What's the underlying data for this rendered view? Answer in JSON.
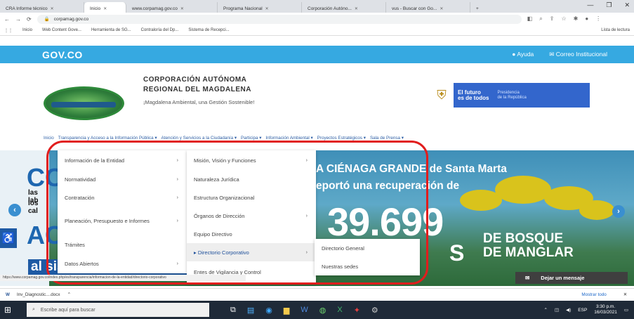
{
  "browser": {
    "tabs": [
      {
        "label": "CRA Informe técnico",
        "active": false
      },
      {
        "label": "Inicio",
        "active": true
      },
      {
        "label": "www.corpamag.gov.co",
        "active": false
      },
      {
        "label": "Programa Nacional",
        "active": false
      },
      {
        "label": "Corporación Autóno...",
        "active": false
      },
      {
        "label": "vus - Buscar con Go...",
        "active": false
      }
    ],
    "new_tab": "+",
    "url": "corpamag.gov.co",
    "bookmarks": [
      "Inicio",
      "Web Content Gove...",
      "Herramienta de SG...",
      "Contraloría del Dp...",
      "Sistema de Recepci..."
    ],
    "reading_list": "Lista de lectura"
  },
  "govco": {
    "logo": "GOV.CO",
    "help": "Ayuda",
    "mail": "Correo Institucional"
  },
  "header": {
    "corp_title_1": "CORPORACIÓN AUTÓNOMA",
    "corp_title_2": "REGIONAL DEL MAGDALENA",
    "corp_sub": "¡Magdalena Ambiental, una Gestión Sostenible!",
    "logo_text": "CORPAMAG",
    "gob_a1": "El futuro",
    "gob_a2": "es de todos",
    "gob_b1": "Presidencia",
    "gob_b2": "de la República"
  },
  "nav": {
    "items": [
      "Inicio",
      "Transparencia y Acceso a la Información Pública ▾",
      "Atención y Servicios a la Ciudadanía ▾",
      "Participa ▾",
      "Información Ambiental ▾",
      "Proyectos Estratégicos ▾",
      "Sala de Prensa ▾"
    ]
  },
  "menu1": [
    {
      "label": "Información de la Entidad",
      "chev": true
    },
    {
      "label": "Normatividad",
      "chev": true
    },
    {
      "label": "Contratación",
      "chev": true
    },
    {
      "label": "Planeación, Presupuesto e Informes",
      "chev": true
    },
    {
      "label": "Trámites",
      "chev": false
    },
    {
      "label": "Datos Abiertos",
      "chev": true
    }
  ],
  "menu2": [
    {
      "label": "Misión, Visión y Funciones",
      "chev": true
    },
    {
      "label": "Naturaleza Jurídica",
      "chev": false
    },
    {
      "label": "Estructura Organizacional",
      "chev": false
    },
    {
      "label": "Órganos de Dirección",
      "chev": true
    },
    {
      "label": "Equipo Directivo",
      "chev": false
    },
    {
      "label": "▸ Directorio Corporativo",
      "chev": true,
      "active": true
    },
    {
      "label": "Entes de Vigilancia y Control",
      "chev": false
    }
  ],
  "menu3": [
    "Directorio General",
    "Nuestras sedes"
  ],
  "hero": {
    "left_big": "CO",
    "left_mid1": "las lab",
    "left_mid2": "los cal",
    "left_big2": "AC",
    "sistema": "al sistema lagu",
    "line1": "A CIÉNAGA GRANDE de Santa Marta",
    "line2": "eportó una recuperación de",
    "number": "39.699",
    "s_letter": "S",
    "bosque1": "DE BOSQUE",
    "bosque2": "DE MANGLAR"
  },
  "status_url": "https://www.corpamag.gov.co/index.php/es/transparencia/informacion-de-la-entidad/directorio-corporativo",
  "chat": "Dejar un mensaje",
  "download": {
    "file": "Inv_Diagnostic....docx",
    "show_all": "Mostrar todo"
  },
  "taskbar": {
    "search_placeholder": "Escribe aquí para buscar",
    "time": "3:30 p.m.",
    "date": "16/03/2021",
    "lang": "ESP"
  }
}
